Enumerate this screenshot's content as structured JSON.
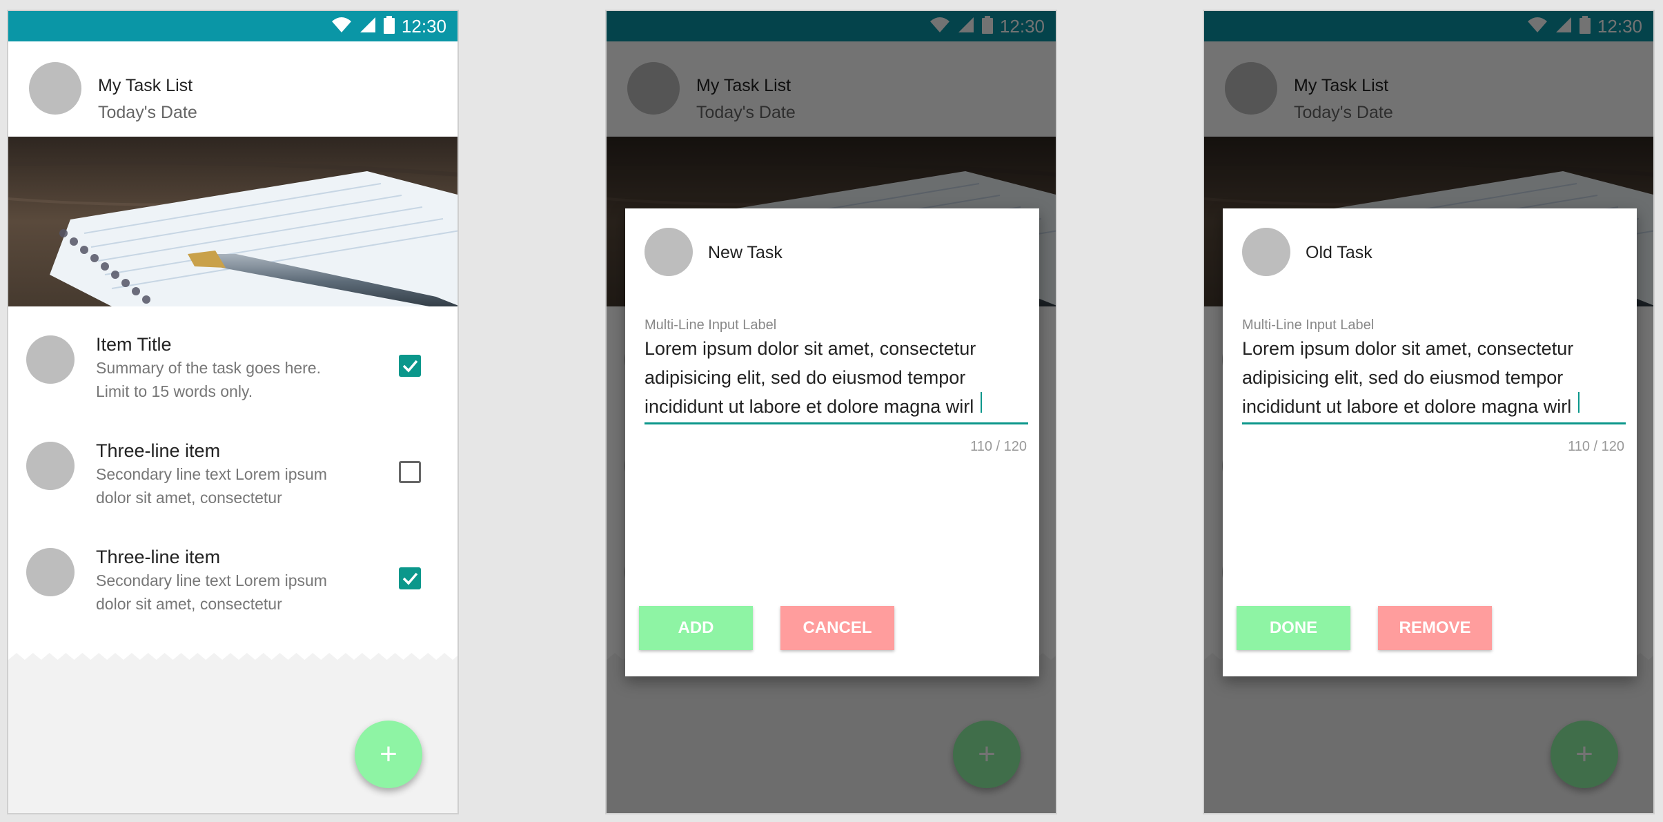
{
  "status": {
    "time": "12:30"
  },
  "app": {
    "title": "My Task List",
    "subtitle": "Today's Date"
  },
  "list": {
    "items": [
      {
        "title": "Item Title",
        "line1": "Summary of the task goes here.",
        "line2": "Limit to 15 words only.",
        "checked": true
      },
      {
        "title": "Three-line item",
        "line1": "Secondary line text Lorem ipsum",
        "line2": "dolor sit amet, consectetur",
        "checked": false
      },
      {
        "title": "Three-line item",
        "line1": "Secondary line text Lorem ipsum",
        "line2": "dolor sit amet, consectetur",
        "checked": true
      }
    ]
  },
  "fab": {
    "label": "+"
  },
  "dialogs": [
    {
      "title": "New Task",
      "input_label": "Multi-Line Input Label",
      "input_lines": [
        "Lorem ipsum dolor sit amet, consectetur",
        "adipisicing elit, sed do eiusmod tempor",
        "incididunt ut labore et dolore magna wirl"
      ],
      "counter": "110 / 120",
      "primary_button": "ADD",
      "secondary_button": "CANCEL"
    },
    {
      "title": "Old Task",
      "input_label": "Multi-Line Input Label",
      "input_lines": [
        "Lorem ipsum dolor sit amet, consectetur",
        "adipisicing elit, sed do eiusmod tempor",
        "incididunt ut labore et dolore magna wirl"
      ],
      "counter": "110 / 120",
      "primary_button": "DONE",
      "secondary_button": "REMOVE"
    }
  ],
  "colors": {
    "status_bar": "#0a96a6",
    "accent": "#0b978b",
    "fab": "#8ef4a4",
    "primary_button": "#8ef4a4",
    "secondary_button": "#ff9d9d"
  },
  "icons": [
    "wifi-icon",
    "cell-signal-icon",
    "battery-icon",
    "checkbox-checked-icon",
    "checkbox-unchecked-icon",
    "plus-icon"
  ]
}
